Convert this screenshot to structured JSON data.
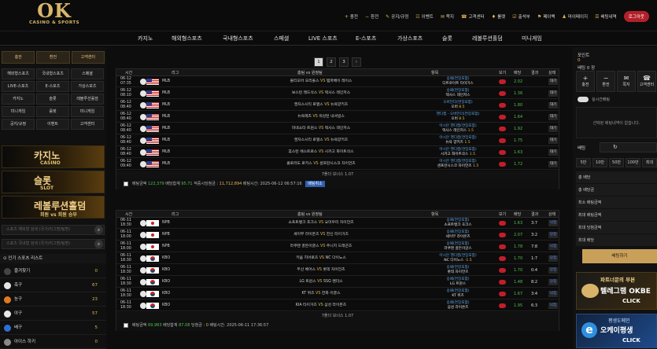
{
  "header": {
    "logo_main": "OK",
    "logo_sub": "CASINO & SPORTS",
    "menu": [
      {
        "icon": "+",
        "label": "충전"
      },
      {
        "icon": "−",
        "label": "환전"
      },
      {
        "icon": "✎",
        "label": "공지/규정"
      },
      {
        "icon": "☷",
        "label": "이벤트"
      },
      {
        "icon": "✉",
        "label": "쪽지"
      },
      {
        "icon": "☎",
        "label": "고객센터"
      },
      {
        "icon": "♦",
        "label": "룰렛"
      },
      {
        "icon": "☑",
        "label": "출석부"
      },
      {
        "icon": "⚑",
        "label": "페이백"
      },
      {
        "icon": "♟",
        "label": "마이페이지"
      },
      {
        "icon": "☰",
        "label": "배팅내역"
      }
    ],
    "logout": "로그아웃"
  },
  "nav": [
    "카지노",
    "해외형스포츠",
    "국내형스포츠",
    "스페셜",
    "LIVE 스포츠",
    "E-스포츠",
    "가상스포츠",
    "슬롯",
    "레볼루션홀덤",
    "미니게임"
  ],
  "left": {
    "buttons": [
      "충전",
      "환전",
      "고객센터"
    ],
    "grid": [
      "해외형스포츠",
      "국내형스포츠",
      "스페셜",
      "LIVE-스포츠",
      "E-스포츠",
      "가상스포츠",
      "카지노",
      "슬롯",
      "레볼루션홀덤",
      "미니게임",
      "룰렛",
      "미니게임",
      "공지/규정",
      "이벤트",
      "고객센터"
    ],
    "banners": [
      {
        "title": "카지노",
        "sub": "CASINO"
      },
      {
        "title": "슬롯",
        "sub": "SLOT"
      },
      {
        "title": "레볼루션홀덤",
        "sub": "회원 vs 회원 승부"
      }
    ],
    "search1": "스포츠 해외형 검색 (국가/리그명/팀명)",
    "search2": "스포츠 국내형 검색 (국가/리그명/팀명)",
    "sports_title": "인기 스포츠 리스트",
    "sports": [
      {
        "name": "즐겨찾기",
        "count": "0",
        "color": "#444"
      },
      {
        "name": "축구",
        "count": "67",
        "color": "#e6e6e6"
      },
      {
        "name": "농구",
        "count": "23",
        "color": "#e07a1f"
      },
      {
        "name": "야구",
        "count": "57",
        "color": "#e6e6e6"
      },
      {
        "name": "배구",
        "count": "5",
        "color": "#2c6fd0"
      },
      {
        "name": "아이스 하키",
        "count": "0",
        "color": "#888"
      }
    ]
  },
  "pagination": [
    "1",
    "2",
    "3",
    "›"
  ],
  "table_headers": [
    "시간",
    "리그",
    "홈팀 vs 원정팀",
    "항목",
    "보기",
    "배당",
    "결과",
    "상태"
  ],
  "tables": [
    {
      "rows": [
        {
          "date": "06-12",
          "time": "07:35",
          "flag": "us",
          "league": "MLB",
          "home": "볼티모어 오리올스",
          "away": "탬파베이 레이스",
          "l1": "승패(연장포함)",
          "l2": "디트로이트 타이거스",
          "h2": "",
          "odd": "2.02",
          "res": "",
          "st": "대기",
          "sb": false
        },
        {
          "date": "06-12",
          "time": "08:10",
          "flag": "us",
          "league": "MLB",
          "home": "보스턴 레드삭스",
          "away": "텍사스 레인저스",
          "l1": "승패(연장포함)",
          "l2": "텍사스 레인저스",
          "h2": "",
          "odd": "1.36",
          "res": "",
          "st": "대기",
          "sb": false
        },
        {
          "date": "06-12",
          "time": "08:40",
          "flag": "us",
          "league": "MLB",
          "home": "캔자스시티 로열스",
          "away": "뉴욕양키즈",
          "l1": "오버언더(연장포함)",
          "l2": "오버",
          "h2": "8.5",
          "odd": "1.80",
          "res": "",
          "st": "대기",
          "sb": false
        },
        {
          "date": "06-12",
          "time": "08:40",
          "flag": "us",
          "league": "MLB",
          "home": "뉴욕메츠",
          "away": "워싱턴 내셔널스",
          "l1": "핸디캡 - 오버언더(연장포함)",
          "l2": "오버",
          "h2": "8.5",
          "odd": "1.64",
          "res": "",
          "st": "대기",
          "sb": false
        },
        {
          "date": "06-12",
          "time": "08:40",
          "flag": "us",
          "league": "MLB",
          "home": "미네소타 트윈스",
          "away": "텍사스 레인저스",
          "l1": "아시안 핸디캡(연장포함)",
          "l2": "텍사스 레인저스",
          "h2": "1.5",
          "odd": "1.92",
          "res": "",
          "st": "대기",
          "sb": false
        },
        {
          "date": "06-12",
          "time": "08:40",
          "flag": "us",
          "league": "MLB",
          "home": "캔자스시티 로열스",
          "away": "뉴욕양키즈",
          "l1": "아시안 핸디캡(연장포함)",
          "l2": "뉴욕 양키즈",
          "h2": "1.5",
          "odd": "1.75",
          "res": "",
          "st": "대기",
          "sb": false
        },
        {
          "date": "06-12",
          "time": "08:40",
          "flag": "us",
          "league": "MLB",
          "home": "휴스턴 애스트로스",
          "away": "시카고 화이트삭스",
          "l1": "아시안 핸디캡(연장포함)",
          "l2": "시카고 화이트삭스",
          "h2": "1.5",
          "odd": "1.63",
          "res": "",
          "st": "대기",
          "sb": false
        },
        {
          "date": "06-12",
          "time": "09:40",
          "flag": "us",
          "league": "MLB",
          "home": "콜로라도 로키스",
          "away": "샌프란시스코 자이언츠",
          "l1": "아시안 핸디캡(연장포함)",
          "l2": "샌프란시스코 자이언츠",
          "h2": "1.5",
          "odd": "1.72",
          "res": "",
          "st": "대기",
          "sb": false
        }
      ],
      "foot": "7폴더 보너스 1.07",
      "sum": {
        "a": "배팅금액",
        "av": "122,379",
        "b": "배당합계",
        "bv": "95.71",
        "c": "적중시당첨금 :",
        "cv": "11,712,894",
        "d": "배팅시간: 2025-06-12 06:57:16",
        "btn": "배팅취소"
      }
    },
    {
      "rows": [
        {
          "date": "06-11",
          "time": "18:30",
          "flag": "jp",
          "league": "NPB",
          "home": "소프트뱅크 호크스",
          "away": "요미우리 자이언츠",
          "l1": "승패(연장포함)",
          "l2": "소프트뱅크 호크스",
          "h2": "",
          "odd": "1.63",
          "res": "3:7",
          "st": "낙첨",
          "sb": true
        },
        {
          "date": "06-11",
          "time": "18:00",
          "flag": "jp",
          "league": "NPB",
          "home": "세이부 라이온즈",
          "away": "한신 타이거즈",
          "l1": "승패(연장포함)",
          "l2": "세이부 라이온즈",
          "h2": "",
          "odd": "2.07",
          "res": "3:2",
          "st": "당첨",
          "sb": true
        },
        {
          "date": "06-11",
          "time": "18:00",
          "flag": "jp",
          "league": "NPB",
          "home": "라쿠텐 골든이글스",
          "away": "주니치 드래곤즈",
          "l1": "승패(연장포함)",
          "l2": "라쿠텐 골든이글스",
          "h2": "",
          "odd": "1.78",
          "res": "7:8",
          "st": "낙첨",
          "sb": true
        },
        {
          "date": "06-11",
          "time": "18:30",
          "flag": "kr",
          "league": "KBO",
          "home": "키움 히어로즈",
          "away": "NC 다이노스",
          "l1": "아시안 핸디캡(연장포함)",
          "l2": "NC 다이노스",
          "h2": "-1.5",
          "odd": "1.70",
          "res": "1:7",
          "st": "당첨",
          "sb": true
        },
        {
          "date": "06-11",
          "time": "18:30",
          "flag": "kr",
          "league": "KBO",
          "home": "두산 베어스",
          "away": "롯데 자이언츠",
          "l1": "승패(연장포함)",
          "l2": "롯데 자이언츠",
          "h2": "",
          "odd": "1.70",
          "res": "0:4",
          "st": "당첨",
          "sb": true
        },
        {
          "date": "06-11",
          "time": "18:30",
          "flag": "kr",
          "league": "KBO",
          "home": "LG 트윈스",
          "away": "SSG 랜더스",
          "l1": "승패(연장포함)",
          "l2": "LG 트윈스",
          "h2": "",
          "odd": "1.48",
          "res": "8:2",
          "st": "당첨",
          "sb": true
        },
        {
          "date": "06-11",
          "time": "18:30",
          "flag": "kr",
          "league": "KBO",
          "home": "KT 위즈",
          "away": "한화 이글스",
          "l1": "승패(연장포함)",
          "l2": "KT 위즈",
          "h2": "",
          "odd": "1.67",
          "res": "3:4",
          "st": "낙첨",
          "sb": true
        },
        {
          "date": "06-11",
          "time": "18:30",
          "flag": "kr",
          "league": "KBO",
          "home": "KIA 타이거즈",
          "away": "삼성 라이온즈",
          "l1": "승패(연장포함)",
          "l2": "삼성 라이온즈",
          "h2": "",
          "odd": "1.95",
          "res": "6:3",
          "st": "낙첨",
          "sb": true
        }
      ],
      "foot": "7폴더 보너스 1.07",
      "sum": {
        "a": "배팅금액",
        "av": "69,983",
        "b": "배당합계",
        "bv": "87.08",
        "c": "당첨금 :",
        "cv": "0",
        "d": "배팅시간: 2025-06-11 17:36:57",
        "btn": ""
      }
    }
  ],
  "right": {
    "point_label": "포인트",
    "point_value": "0",
    "bet_count": "배팅 0 장",
    "tabs": [
      {
        "icon": "+",
        "label": "충전"
      },
      {
        "icon": "−",
        "label": "환전"
      },
      {
        "icon": "✉",
        "label": "쪽지"
      },
      {
        "icon": "☎",
        "label": "고객센터"
      }
    ],
    "toggle_label": "실시간배팅",
    "empty": "선택된 배팅내역이 없습니다.",
    "bet_label": "배팅",
    "amounts": [
      "5만",
      "10만",
      "50만",
      "100만",
      "최대"
    ],
    "rows": [
      "총 배당",
      "총 배당금",
      "최소 배팅금액",
      "최대 배팅금액",
      "최대 당첨금액",
      "최대 배당"
    ],
    "bet_button": "배팅하기",
    "banner1": {
      "line1": "파트너문의 부본",
      "line2": "텔레그램 OKBE",
      "line3": "CLICK"
    },
    "banner2": {
      "line1": "평생도메인",
      "line2": "오케이평생",
      "line3": "CLICK"
    }
  }
}
